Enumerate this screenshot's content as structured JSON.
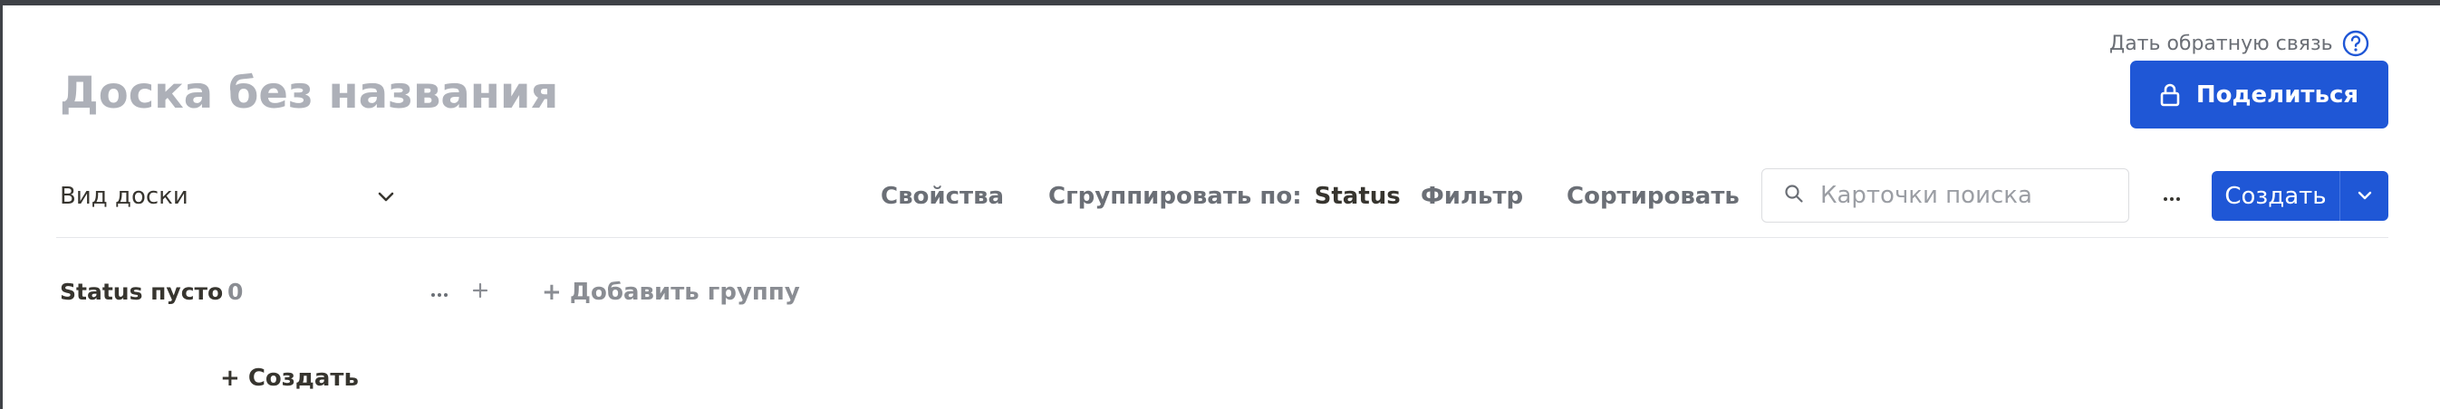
{
  "header": {
    "feedback_link": "Дать обратную связь",
    "share_button": "Поделиться",
    "board_title": "Доска без названия"
  },
  "toolbar": {
    "view_select": "Вид доски",
    "properties": "Свойства",
    "group_by_label": "Сгруппировать по:",
    "group_by_value": "Status",
    "filter": "Фильтр",
    "sort": "Сортировать",
    "search_placeholder": "Карточки поиска",
    "search_value": "",
    "create_button": "Создать"
  },
  "board": {
    "groups": [
      {
        "name": "Status пусто",
        "count": "0"
      }
    ],
    "add_group": "+ Добавить группу",
    "add_card": "+ Создать"
  },
  "colors": {
    "accent": "#1f57d6",
    "title_muted": "#adb0b8",
    "text_muted": "#6b6f76"
  },
  "icons": {
    "help": "help-circle-icon",
    "lock": "lock-icon",
    "chevron": "chevron-down-icon",
    "search": "search-icon",
    "more": "more-horizontal-icon",
    "plus": "plus-icon"
  }
}
